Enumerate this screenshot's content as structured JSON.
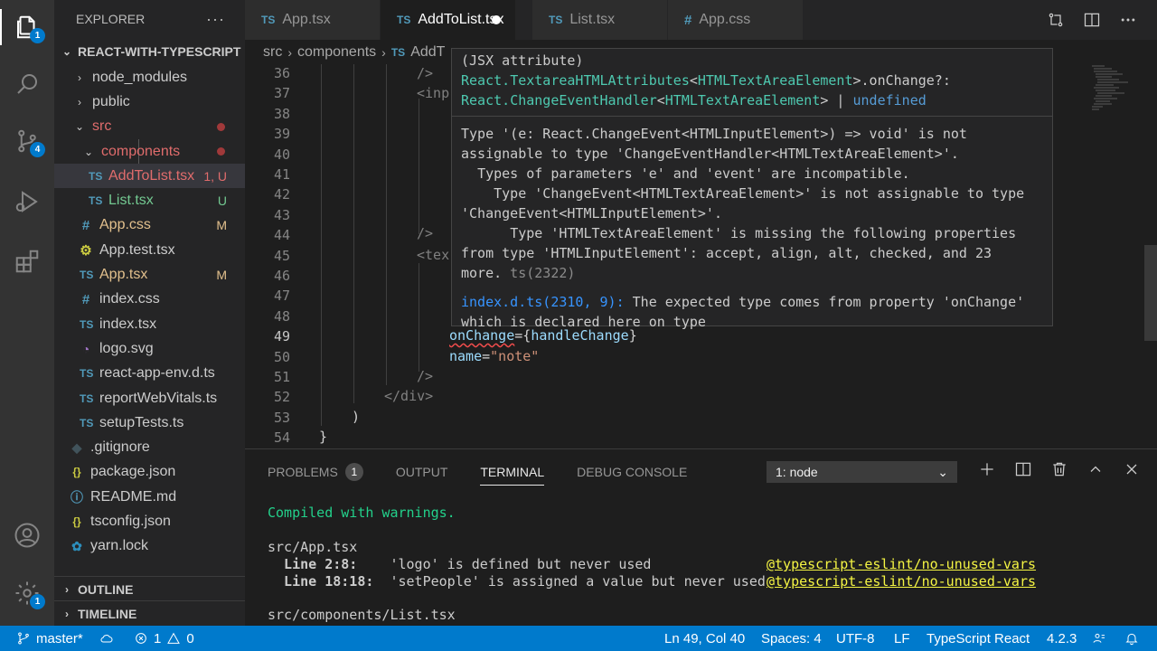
{
  "explorer": {
    "title": "EXPLORER",
    "more": "···",
    "root": "REACT-WITH-TYPESCRIPT",
    "items": [
      {
        "label": "node_modules",
        "icon": "chevron-right"
      },
      {
        "label": "public",
        "icon": "chevron-right"
      },
      {
        "label": "src",
        "icon": "chevron-down"
      },
      {
        "label": "components",
        "icon": "chevron-down"
      },
      {
        "label": "AddToList.tsx",
        "icon": "TS",
        "decoration": "1, U"
      },
      {
        "label": "List.tsx",
        "icon": "TS",
        "decoration": "U"
      },
      {
        "label": "App.css",
        "icon": "#",
        "decoration": "M"
      },
      {
        "label": "App.test.tsx",
        "icon": "gear"
      },
      {
        "label": "App.tsx",
        "icon": "TS",
        "decoration": "M"
      },
      {
        "label": "index.css",
        "icon": "#"
      },
      {
        "label": "index.tsx",
        "icon": "TS"
      },
      {
        "label": "logo.svg",
        "icon": "svg"
      },
      {
        "label": "react-app-env.d.ts",
        "icon": "TS"
      },
      {
        "label": "reportWebVitals.ts",
        "icon": "TS"
      },
      {
        "label": "setupTests.ts",
        "icon": "TS"
      },
      {
        "label": ".gitignore",
        "icon": "git"
      },
      {
        "label": "package.json",
        "icon": "{}"
      },
      {
        "label": "README.md",
        "icon": "info"
      },
      {
        "label": "tsconfig.json",
        "icon": "{}"
      },
      {
        "label": "yarn.lock",
        "icon": "yarn"
      }
    ],
    "outline": "OUTLINE",
    "timeline": "TIMELINE"
  },
  "activity_badges": {
    "explorer": "1",
    "scm": "4",
    "settings": "1"
  },
  "tabs": [
    {
      "label": "App.tsx",
      "icon": "TS"
    },
    {
      "label": "AddToList.tsx",
      "icon": "TS"
    },
    {
      "label": "List.tsx",
      "icon": "TS"
    },
    {
      "label": "App.css",
      "icon": "#"
    }
  ],
  "breadcrumb": {
    "src": "src",
    "components": "components",
    "file_icon": "TS",
    "file": "AddT"
  },
  "editor": {
    "line_numbers": [
      "36",
      "37",
      "38",
      "39",
      "40",
      "41",
      "42",
      "43",
      "44",
      "45",
      "46",
      "47",
      "48",
      "49",
      "50",
      "51",
      "52",
      "53",
      "54"
    ],
    "l36": "/>",
    "l37": "<inp",
    "l44": "/>",
    "l45": "<tex",
    "l49_attr": "onChange",
    "l49_eq": "=",
    "l49_open": "{",
    "l49_fn": "handleChange",
    "l49_close": "}",
    "l50_attr": "name",
    "l50_eq": "=",
    "l50_val": "\"note\"",
    "l51": "/>",
    "l52": "</div>",
    "l53": ")",
    "l54": "}"
  },
  "hover": {
    "sig1_a": "(JSX attribute)",
    "sig2_a": "React.",
    "sig2_b": "TextareaHTMLAttributes",
    "sig2_c": "<",
    "sig2_d": "HTMLTextAreaElement",
    "sig2_e": ">.onChange?:",
    "sig3_a": "React.",
    "sig3_b": "ChangeEventHandler",
    "sig3_c": "<",
    "sig3_d": "HTMLTextAreaElement",
    "sig3_e": "> | ",
    "sig3_f": "undefined",
    "message": "Type '(e: React.ChangeEvent<HTMLInputElement>) => void' is not\nassignable to type 'ChangeEventHandler<HTMLTextAreaElement>'.\n  Types of parameters 'e' and 'event' are incompatible.\n    Type 'ChangeEvent<HTMLTextAreaElement>' is not assignable to type\n'ChangeEvent<HTMLInputElement>'.\n      Type 'HTMLTextAreaElement' is missing the following properties\nfrom type 'HTMLInputElement': accept, align, alt, checked, and 23\nmore.",
    "code": " ts(2322)",
    "related_link": "index.d.ts(2310, 9):",
    "related_text": " The expected type comes from property 'onChange'\nwhich is declared here on type"
  },
  "panel": {
    "tabs": [
      "PROBLEMS",
      "OUTPUT",
      "TERMINAL",
      "DEBUG CONSOLE"
    ],
    "problems_count": "1",
    "terminal_select": "1: node",
    "lines": {
      "compiled": "Compiled with warnings.",
      "file1": "src/App.tsx",
      "w1_loc": "  Line 2:8:",
      "w1_msg": "    'logo' is defined but never used",
      "w1_rule": "@typescript-eslint/no-unused-vars",
      "w2_loc": "  Line 18:18:",
      "w2_msg": "  'setPeople' is assigned a value but never used",
      "w2_rule": "@typescript-eslint/no-unused-vars",
      "file2": "src/components/List.tsx"
    }
  },
  "status": {
    "branch": "master*",
    "errors": "1",
    "warnings": "0",
    "position": "Ln 49, Col 40",
    "spaces": "Spaces: 4",
    "encoding": "UTF-8",
    "eol": "LF",
    "language": "TypeScript React",
    "version": "4.2.3"
  },
  "colors": {
    "accent": "#007acc",
    "ts_icon": "#519aba",
    "modified": "#e2c08d",
    "untracked": "#73c991",
    "error": "#f14c4c"
  }
}
